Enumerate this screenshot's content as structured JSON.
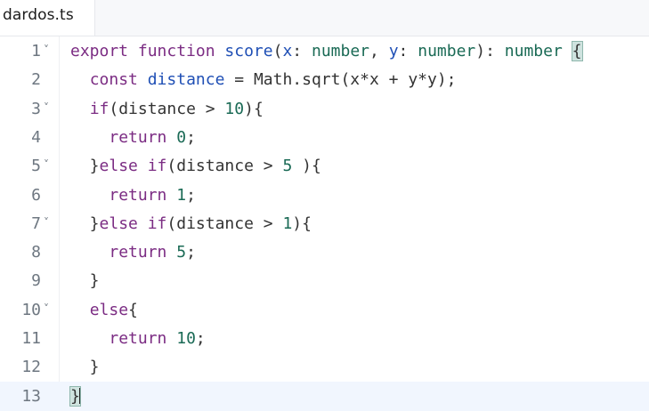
{
  "tab": {
    "label": "dardos.ts"
  },
  "lines": [
    {
      "num": "1",
      "fold": "˅"
    },
    {
      "num": "2",
      "fold": ""
    },
    {
      "num": "3",
      "fold": "˅"
    },
    {
      "num": "4",
      "fold": ""
    },
    {
      "num": "5",
      "fold": "˅"
    },
    {
      "num": "6",
      "fold": ""
    },
    {
      "num": "7",
      "fold": "˅"
    },
    {
      "num": "8",
      "fold": ""
    },
    {
      "num": "9",
      "fold": ""
    },
    {
      "num": "10",
      "fold": "˅"
    },
    {
      "num": "11",
      "fold": ""
    },
    {
      "num": "12",
      "fold": ""
    },
    {
      "num": "13",
      "fold": ""
    }
  ],
  "tokens": {
    "l1": [
      "export",
      " ",
      "function",
      " ",
      "score",
      "(",
      "x",
      ": ",
      "number",
      ", ",
      "y",
      ": ",
      "number",
      "): ",
      "number",
      " ",
      "{"
    ],
    "l2": [
      "  ",
      "const",
      " ",
      "distance",
      " = ",
      "Math.sqrt(x*x + y*y);"
    ],
    "l3": [
      "  ",
      "if",
      "(distance > ",
      "10",
      "){"
    ],
    "l4": [
      "    ",
      "return",
      " ",
      "0",
      ";"
    ],
    "l5": [
      "  }",
      "else",
      " ",
      "if",
      "(distance > ",
      "5",
      " ){"
    ],
    "l6": [
      "    ",
      "return",
      " ",
      "1",
      ";"
    ],
    "l7": [
      "  }",
      "else",
      " ",
      "if",
      "(distance > ",
      "1",
      "){"
    ],
    "l8": [
      "    ",
      "return",
      " ",
      "5",
      ";"
    ],
    "l9": [
      "  }"
    ],
    "l10": [
      "  ",
      "else",
      "{"
    ],
    "l11": [
      "    ",
      "return",
      " ",
      "10",
      ";"
    ],
    "l12": [
      "  }"
    ],
    "l13": [
      "}"
    ]
  },
  "colors": {
    "keyword": "#7b2c83",
    "function": "#1f4fb5",
    "type": "#1a6a55",
    "number": "#1a6a55",
    "active_line": "#f1f6fe"
  }
}
